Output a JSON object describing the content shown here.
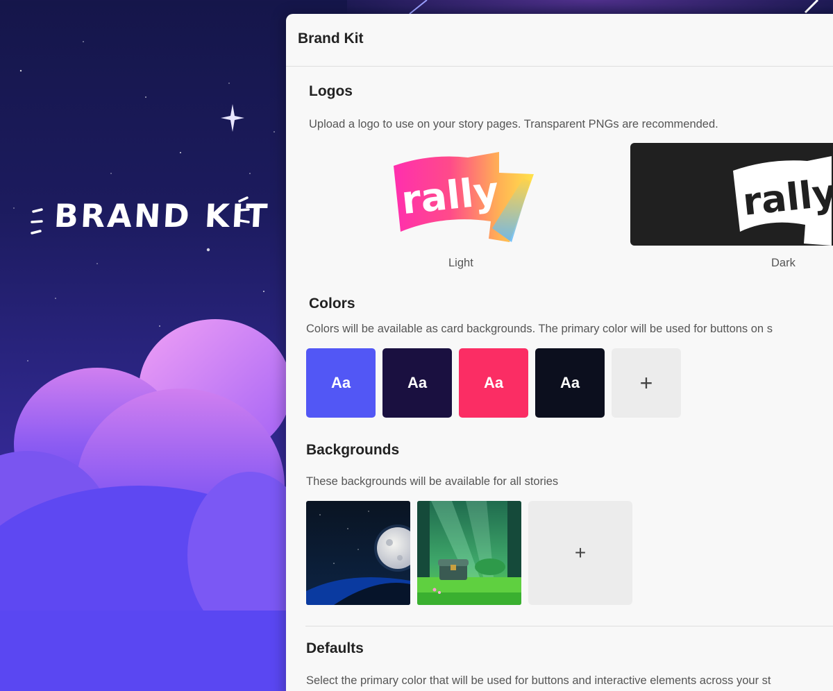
{
  "hero": {
    "title": "BRAND KIT"
  },
  "panel": {
    "title": "Brand Kit"
  },
  "logos": {
    "title": "Logos",
    "description": "Upload a logo to use on your story pages. Transparent PNGs are recommended.",
    "items": [
      {
        "label": "Light",
        "wordmark": "rally"
      },
      {
        "label": "Dark",
        "wordmark": "rally"
      }
    ]
  },
  "colors": {
    "title": "Colors",
    "description": "Colors will be available as card backgrounds. The primary color will be used for buttons on s",
    "swatches": [
      {
        "label": "Aa",
        "color": "#5257f5"
      },
      {
        "label": "Aa",
        "color": "#1a1040"
      },
      {
        "label": "Aa",
        "color": "#fb2d64"
      },
      {
        "label": "Aa",
        "color": "#0c0f1e"
      }
    ],
    "add_label": "+"
  },
  "backgrounds": {
    "title": "Backgrounds",
    "description": "These backgrounds will be available for all stories",
    "items": [
      {
        "name": "moon-night",
        "icon": "moon-night-thumbnail"
      },
      {
        "name": "forest-chest",
        "icon": "forest-chest-thumbnail"
      }
    ],
    "add_label": "+"
  },
  "defaults": {
    "title": "Defaults",
    "description": "Select the primary color that will be used for buttons and interactive elements across your st"
  }
}
